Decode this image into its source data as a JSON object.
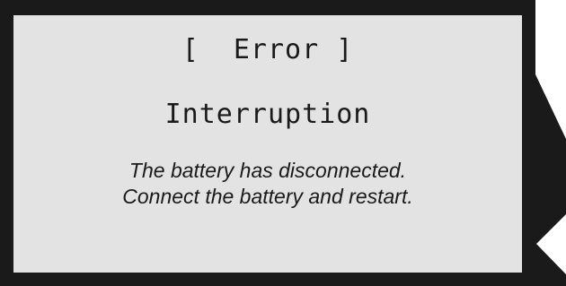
{
  "screen": {
    "header": "[  Error ]",
    "heading": "Interruption",
    "message_lines": [
      "The battery has disconnected.",
      "Connect the battery and restart."
    ]
  },
  "colors": {
    "frame": "#1a1a1a",
    "screen_background": "#e3e3e3",
    "text": "#1a1a1a",
    "indicator": "#ffffff"
  },
  "icons": {
    "side_indicator": "left-triangle-icon"
  }
}
